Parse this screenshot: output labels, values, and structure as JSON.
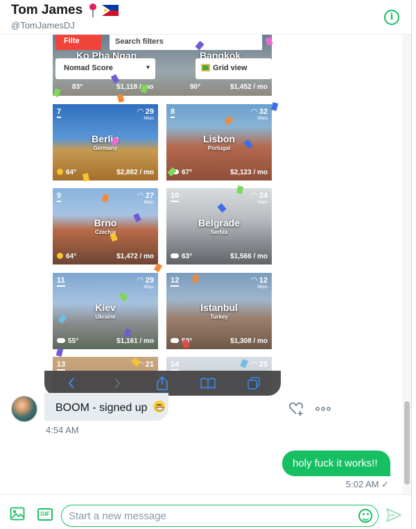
{
  "header": {
    "name": "Tom James",
    "handle": "@TomJamesDJ",
    "info_icon": "info-icon"
  },
  "screenshot": {
    "filter_label": "Filte",
    "search_filters": "Search filters",
    "top_cities": [
      "Ko Pha Ngan",
      "Bangkok"
    ],
    "sort_select": "Nomad Score",
    "view_select": "Grid view",
    "top_prices": [
      "$1,118 / mo",
      "$1,452 / mo"
    ],
    "top_temps": [
      "83°",
      "90°"
    ],
    "cards": [
      {
        "rank": "7",
        "city": "Berlin",
        "country": "Germany",
        "speed": "29",
        "speed_unit": "Mbps",
        "temp": "64°",
        "price": "$2,882 / mo",
        "weather": "sun"
      },
      {
        "rank": "8",
        "city": "Lisbon",
        "country": "Portugal",
        "speed": "32",
        "speed_unit": "Mbps",
        "temp": "67°",
        "price": "$2,123 / mo",
        "weather": "cloud"
      },
      {
        "rank": "9",
        "city": "Brno",
        "country": "Czechia",
        "speed": "27",
        "speed_unit": "Mbps",
        "temp": "64°",
        "price": "$1,472 / mo",
        "weather": "sun"
      },
      {
        "rank": "10",
        "city": "Belgrade",
        "country": "Serbia",
        "speed": "24",
        "speed_unit": "Mbps",
        "temp": "63°",
        "price": "$1,566 / mo",
        "weather": "cloud"
      },
      {
        "rank": "11",
        "city": "Kiev",
        "country": "Ukraine",
        "speed": "29",
        "speed_unit": "Mbps",
        "temp": "55°",
        "price": "$1,161 / mo",
        "weather": "cloud"
      },
      {
        "rank": "12",
        "city": "Istanbul",
        "country": "Turkey",
        "speed": "12",
        "speed_unit": "Mbps",
        "temp": "58°",
        "price": "$1,308 / mo",
        "weather": "cloud"
      },
      {
        "rank": "13",
        "city": "",
        "country": "",
        "speed": "21",
        "speed_unit": "",
        "temp": "",
        "price": "",
        "weather": ""
      },
      {
        "rank": "14",
        "city": "",
        "country": "",
        "speed": "25",
        "speed_unit": "",
        "temp": "",
        "price": "",
        "weather": ""
      }
    ],
    "toolbar_icons": [
      "back-icon",
      "forward-icon",
      "share-icon",
      "bookmarks-icon",
      "tabs-icon"
    ]
  },
  "received": {
    "text": "BOOM - signed up",
    "emoji": "grinning-face-icon",
    "time": "4:54 AM"
  },
  "sent": {
    "text": "holy fuck it works!!",
    "time": "5:02 AM ✓"
  },
  "composer": {
    "placeholder": "Start a new message",
    "value": ""
  },
  "colors": {
    "accent": "#17bf63",
    "received_bubble": "#e6ecf0",
    "secondary_text": "#657786",
    "filter_red": "#f0443a",
    "toolbar_bg": "#464648"
  }
}
